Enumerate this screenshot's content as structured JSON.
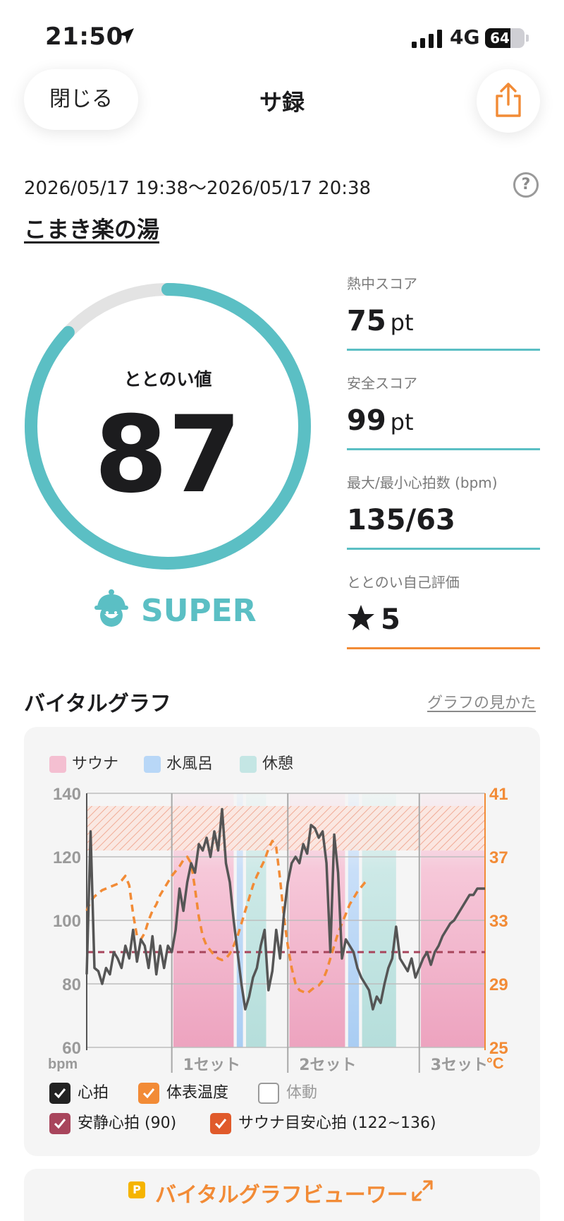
{
  "status_bar": {
    "time": "21:50",
    "network": "4G",
    "battery": "64",
    "battery_level": 0.64
  },
  "header": {
    "close_label": "閉じる",
    "title": "サ録"
  },
  "session": {
    "datetime": "2026/05/17 19:38〜2026/05/17 20:38",
    "help": "?",
    "place": "こまき楽の湯"
  },
  "gauge": {
    "label": "ととのい値",
    "value": "87",
    "percent": 87,
    "rank": "SUPER"
  },
  "stats": [
    {
      "label": "熱中スコア",
      "value": "75",
      "unit": "pt"
    },
    {
      "label": "安全スコア",
      "value": "99",
      "unit": "pt"
    },
    {
      "label": "最大/最小心拍数 (bpm)",
      "value": "135/63",
      "unit": ""
    },
    {
      "label": "ととのい自己評価",
      "value": "5",
      "unit": ""
    }
  ],
  "vital": {
    "title": "バイタルグラフ",
    "guide_link": "グラフの見かた",
    "legend": [
      {
        "label": "サウナ",
        "color": "#f4bfd1"
      },
      {
        "label": "水風呂",
        "color": "#b8d7f7"
      },
      {
        "label": "休憩",
        "color": "#c4e6e4"
      }
    ],
    "checkboxes": [
      {
        "label": "心拍",
        "color": "#222222",
        "checked": true
      },
      {
        "label": "体表温度",
        "color": "#f28b36",
        "checked": true
      },
      {
        "label": "体動",
        "color": "#9a9a9a",
        "checked": false
      },
      {
        "label": "安静心拍 (90)",
        "color": "#a8455c",
        "checked": true
      },
      {
        "label": "サウナ目安心拍 (122~136)",
        "color": "#e05a2b",
        "checked": true
      }
    ],
    "viewer_button": "バイタルグラフビューワー",
    "viewer_icon": "P"
  },
  "chart_data": {
    "type": "line",
    "y_left": {
      "label": "bpm",
      "ticks": [
        140,
        120,
        100,
        80,
        60
      ],
      "range": [
        60,
        140
      ]
    },
    "y_right": {
      "label": "°C",
      "ticks": [
        41,
        37,
        33,
        29,
        25
      ],
      "range": [
        25,
        41
      ]
    },
    "x": [
      0,
      5,
      10,
      15,
      20,
      25,
      30,
      35,
      40,
      45,
      50,
      55,
      60,
      65,
      70,
      75,
      80,
      85,
      90,
      95,
      100,
      105,
      110,
      115,
      120,
      125,
      130,
      135,
      140,
      145,
      150,
      155,
      160,
      165,
      170,
      175,
      180,
      185,
      190,
      195,
      200,
      205,
      210,
      215,
      220,
      225,
      230,
      235,
      240,
      245,
      250,
      255,
      260,
      265,
      270,
      275,
      280,
      285,
      290,
      295,
      300,
      305,
      310,
      315,
      320,
      325,
      330,
      335,
      340,
      345,
      350,
      355,
      360,
      365,
      370,
      375,
      380,
      385,
      390,
      395,
      400,
      405,
      410,
      415,
      420,
      425,
      430,
      435,
      440,
      445,
      450,
      455,
      460,
      465,
      470,
      475,
      480,
      485,
      490,
      495,
      500,
      505,
      510,
      515
    ],
    "series": [
      {
        "name": "心拍",
        "color": "#555555",
        "values": [
          83,
          128,
          85,
          84,
          80,
          85,
          83,
          90,
          88,
          85,
          92,
          88,
          97,
          87,
          94,
          92,
          85,
          95,
          83,
          92,
          85,
          92,
          90,
          97,
          110,
          103,
          112,
          118,
          115,
          124,
          122,
          126,
          120,
          128,
          122,
          135,
          118,
          112,
          100,
          90,
          80,
          72,
          76,
          82,
          85,
          92,
          97,
          78,
          84,
          97,
          88,
          102,
          112,
          118,
          120,
          118,
          124,
          121,
          130,
          129,
          126,
          128,
          118,
          90,
          127,
          115,
          88,
          94,
          92,
          90,
          85,
          82,
          80,
          78,
          72,
          76,
          74,
          80,
          85,
          88,
          98,
          88,
          86,
          84,
          88,
          82,
          85,
          88,
          90,
          86,
          90,
          92,
          95,
          97,
          99,
          100,
          102,
          104,
          106,
          108,
          108,
          110,
          110,
          110
        ]
      },
      {
        "name": "体表温度",
        "color": "#f28b36",
        "values": [
          33.6,
          34.2,
          34.5,
          34.7,
          34.9,
          35.0,
          35.1,
          35.2,
          35.3,
          35.5,
          35.8,
          35.2,
          33.4,
          32.0,
          31.8,
          32.2,
          33.0,
          33.6,
          34.0,
          34.6,
          35.0,
          35.4,
          35.8,
          36.1,
          36.4,
          36.8,
          37.0,
          36.6,
          35.0,
          33.2,
          32.0,
          31.4,
          31.1,
          30.8,
          30.6,
          30.5,
          30.6,
          30.9,
          31.4,
          32.0,
          32.8,
          33.6,
          34.4,
          35.2,
          35.8,
          36.3,
          36.8,
          37.5,
          38.0,
          37.6,
          35.6,
          33.2,
          31.4,
          30.0,
          29.0,
          28.6,
          28.5,
          28.4,
          28.6,
          28.8,
          28.9,
          29.2,
          29.8,
          30.6,
          31.4,
          32.2,
          32.8,
          33.4,
          34.0,
          34.4,
          34.8,
          35.1,
          35.4,
          35.6
        ]
      },
      {
        "name": "安静心拍 (90)",
        "color": "#a8455c",
        "value": 90
      },
      {
        "name": "サウナ目安心拍 (122~136)",
        "color": "#e05a2b",
        "range": [
          122,
          136
        ]
      }
    ],
    "phases": [
      {
        "type": "サウナ",
        "start": 112,
        "end": 190
      },
      {
        "type": "水風呂",
        "start": 194,
        "end": 202
      },
      {
        "type": "休憩",
        "start": 206,
        "end": 232
      },
      {
        "type": "サウナ",
        "start": 262,
        "end": 334
      },
      {
        "type": "水風呂",
        "start": 338,
        "end": 352
      },
      {
        "type": "休憩",
        "start": 356,
        "end": 400
      },
      {
        "type": "サウナ",
        "start": 432,
        "end": 515
      }
    ],
    "sets": [
      {
        "label": "1セット",
        "x": 110
      },
      {
        "label": "2セット",
        "x": 260
      },
      {
        "label": "3セット",
        "x": 430
      }
    ],
    "x_range": [
      0,
      515
    ],
    "grid": true
  }
}
